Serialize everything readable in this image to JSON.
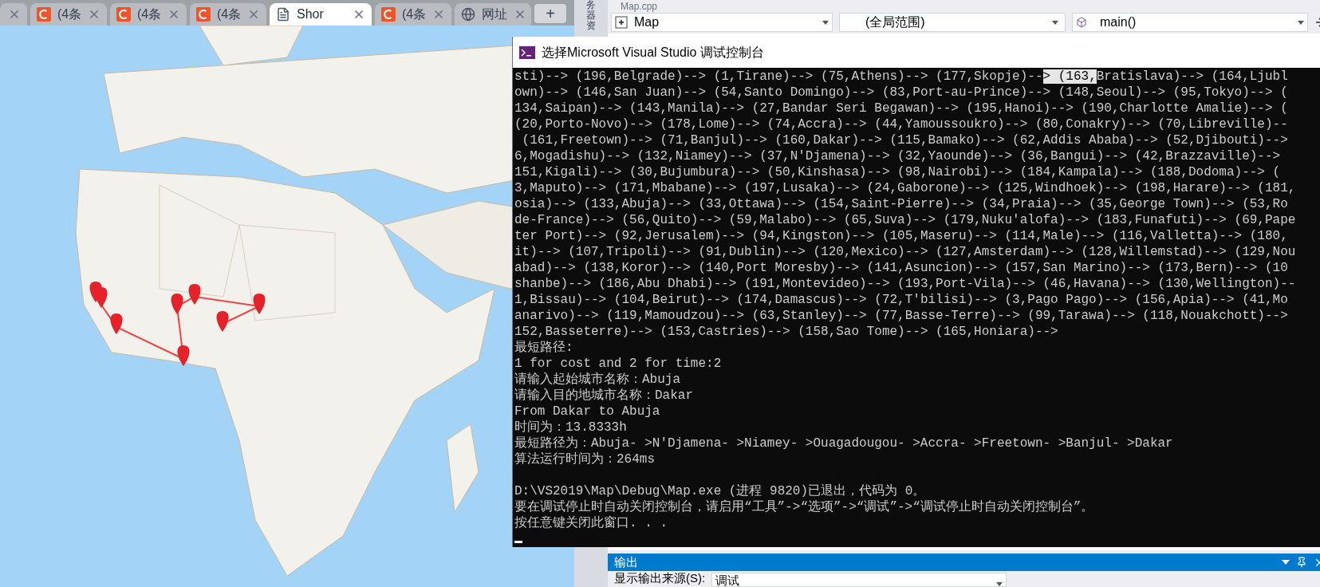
{
  "browser": {
    "tabs": [
      {
        "kind": "cut",
        "selected": false
      },
      {
        "kind": "site",
        "label": "(4条",
        "selected": false
      },
      {
        "kind": "site",
        "label": "(4条",
        "selected": false
      },
      {
        "kind": "site",
        "label": "(4条",
        "selected": false
      },
      {
        "kind": "doc",
        "label": "Shor",
        "selected": true
      },
      {
        "kind": "site",
        "label": "(4条",
        "selected": false
      },
      {
        "kind": "globe",
        "label": "网址",
        "selected": false
      }
    ],
    "new_tab": "+"
  },
  "ide": {
    "file_tab": "Map.cpp",
    "side_panel_label": "务器资",
    "navbar": {
      "project": "Map",
      "scope": "(全局范围)",
      "member": "main()"
    },
    "output_panel": {
      "title": "输出",
      "source_label": "显示输出来源(S):",
      "source_value": "调试"
    }
  },
  "console": {
    "title": "选择Microsoft Visual Studio 调试控制台",
    "lines": [
      {
        "kind": "selection",
        "segments": [
          {
            "text": "sti)--> (196,Belgrade)--> (1,Tirane)--> (75,Athens)--> (177,Skopje)--",
            "selected": false
          },
          {
            "text": "> (163,",
            "selected": true
          },
          {
            "text": "Bratislava)--> (164,Ljubl",
            "selected": false
          }
        ]
      },
      {
        "kind": "text",
        "text": "own)--> (146,San Juan)--> (54,Santo Domingo)--> (83,Port-au-Prince)--> (148,Seoul)--> (95,Tokyo)--> ("
      },
      {
        "kind": "text",
        "text": "134,Saipan)--> (143,Manila)--> (27,Bandar Seri Begawan)--> (195,Hanoi)--> (190,Charlotte Amalie)--> ("
      },
      {
        "kind": "text",
        "text": "(20,Porto-Novo)--> (178,Lome)--> (74,Accra)--> (44,Yamoussoukro)--> (80,Conakry)--> (70,Libreville)--"
      },
      {
        "kind": "text",
        "text": " (161,Freetown)--> (71,Banjul)--> (160,Dakar)--> (115,Bamako)--> (62,Addis Ababa)--> (52,Djibouti)-->"
      },
      {
        "kind": "text",
        "text": "6,Mogadishu)--> (132,Niamey)--> (37,N'Djamena)--> (32,Yaounde)--> (36,Bangui)--> (42,Brazzaville)-->"
      },
      {
        "kind": "text",
        "text": "151,Kigali)--> (30,Bujumbura)--> (50,Kinshasa)--> (98,Nairobi)--> (184,Kampala)--> (188,Dodoma)--> ("
      },
      {
        "kind": "text",
        "text": "3,Maputo)--> (171,Mbabane)--> (197,Lusaka)--> (24,Gaborone)--> (125,Windhoek)--> (198,Harare)--> (181,"
      },
      {
        "kind": "text",
        "text": "osia)--> (133,Abuja)--> (33,Ottawa)--> (154,Saint-Pierre)--> (34,Praia)--> (35,George Town)--> (53,Ro"
      },
      {
        "kind": "text",
        "text": "de-France)--> (56,Quito)--> (59,Malabo)--> (65,Suva)--> (179,Nuku'alofa)--> (183,Funafuti)--> (69,Pape"
      },
      {
        "kind": "text",
        "text": "ter Port)--> (92,Jerusalem)--> (94,Kingston)--> (105,Maseru)--> (114,Male)--> (116,Valletta)--> (180,"
      },
      {
        "kind": "text",
        "text": "it)--> (107,Tripoli)--> (91,Dublin)--> (120,Mexico)--> (127,Amsterdam)--> (128,Willemstad)--> (129,Nou"
      },
      {
        "kind": "text",
        "text": "abad)--> (138,Koror)--> (140,Port Moresby)--> (141,Asuncion)--> (157,San Marino)--> (173,Bern)--> (10"
      },
      {
        "kind": "text",
        "text": "shanbe)--> (186,Abu Dhabi)--> (191,Montevideo)--> (193,Port-Vila)--> (46,Havana)--> (130,Wellington)--"
      },
      {
        "kind": "text",
        "text": "1,Bissau)--> (104,Beirut)--> (174,Damascus)--> (72,T'bilisi)--> (3,Pago Pago)--> (156,Apia)--> (41,Mo"
      },
      {
        "kind": "text",
        "text": "anarivo)--> (119,Mamoudzou)--> (63,Stanley)--> (77,Basse-Terre)--> (99,Tarawa)--> (118,Nouakchott)-->"
      },
      {
        "kind": "text",
        "text": "152,Basseterre)--> (153,Castries)--> (158,Sao Tome)--> (165,Honiara)-->"
      },
      {
        "kind": "text",
        "text": "最短路径:"
      },
      {
        "kind": "text",
        "text": "1 for cost and 2 for time:2"
      },
      {
        "kind": "text",
        "text": "请输入起始城市名称：Abuja"
      },
      {
        "kind": "text",
        "text": "请输入目的地城市名称：Dakar"
      },
      {
        "kind": "text",
        "text": "From Dakar to Abuja"
      },
      {
        "kind": "text",
        "text": "时间为：13.8333h"
      },
      {
        "kind": "text",
        "text": "最短路径为：Abuja- >N'Djamena- >Niamey- >Ouagadougou- >Accra- >Freetown- >Banjul- >Dakar"
      },
      {
        "kind": "text",
        "text": "算法运行时间为：264ms"
      },
      {
        "kind": "blank"
      },
      {
        "kind": "text",
        "text": "D:\\VS2019\\Map\\Debug\\Map.exe (进程 9820)已退出，代码为 0。"
      },
      {
        "kind": "text",
        "text": "要在调试停止时自动关闭控制台，请启用“工具”->“选项”->“调试”->“调试停止时自动关闭控制台”。"
      },
      {
        "kind": "text",
        "text": "按任意键关闭此窗口. . ."
      }
    ]
  }
}
